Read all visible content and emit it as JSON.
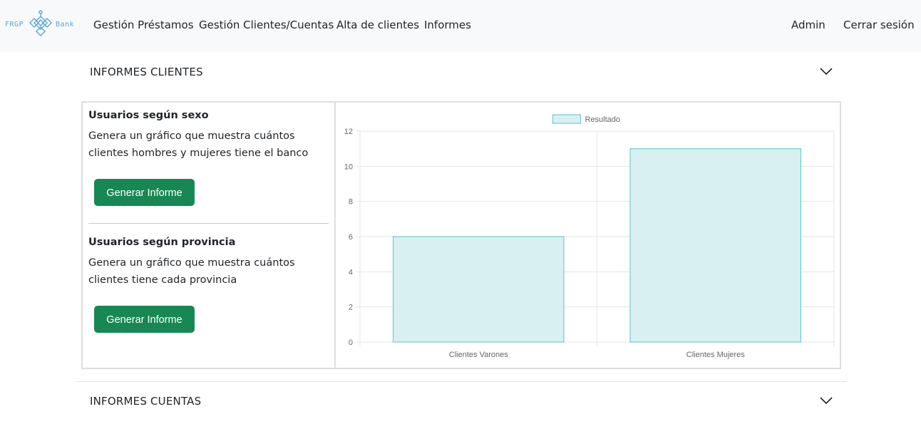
{
  "navbar": {
    "brand_left": "FRGP",
    "brand_right": "Bank",
    "links": [
      "Gestión Préstamos",
      "Gestión Clientes/Cuentas",
      "Alta de clientes",
      "Informes"
    ],
    "user": "Admin",
    "logout": "Cerrar sesión"
  },
  "sections": {
    "clients_title": "INFORMES CLIENTES",
    "accounts_title": "INFORMES CUENTAS"
  },
  "reports": [
    {
      "title": "Usuarios según sexo",
      "description": "Genera un gráfico que muestra cuántos clientes hombres y mujeres tiene el banco",
      "button": "Generar Informe"
    },
    {
      "title": "Usuarios según provincia",
      "description": "Genera un gráfico que muestra cuántos clientes tiene cada provincia",
      "button": "Generar Informe"
    }
  ],
  "chart_data": {
    "type": "bar",
    "categories": [
      "Clientes Varones",
      "Clientes Mujeres"
    ],
    "series": [
      {
        "name": "Resultado",
        "values": [
          6,
          11
        ]
      }
    ],
    "ylim": [
      0,
      12
    ],
    "yticks": [
      0,
      2,
      4,
      6,
      8,
      10,
      12
    ],
    "grid": true,
    "legend": "top-center",
    "colors": {
      "fill": "#d9f0f2",
      "stroke": "#74c9cc",
      "grid": "#e6e6e6"
    }
  }
}
